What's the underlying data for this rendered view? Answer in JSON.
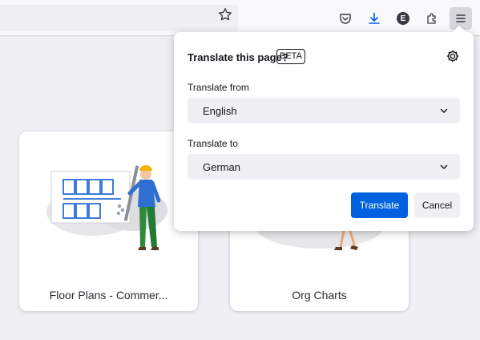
{
  "toolbar": {
    "icons": [
      "star-icon",
      "pocket-icon",
      "download-icon",
      "extension-account-icon",
      "extensions-icon",
      "menu-icon"
    ],
    "account_initial": "E",
    "accent_color": "#0061e0"
  },
  "cards": [
    {
      "title": "Floor Plans - Commer..."
    },
    {
      "title": "Org Charts"
    }
  ],
  "translation_panel": {
    "title": "Translate this page?",
    "badge": "BETA",
    "from_label": "Translate from",
    "from_value": "English",
    "to_label": "Translate to",
    "to_value": "German",
    "translate_button": "Translate",
    "cancel_button": "Cancel"
  }
}
